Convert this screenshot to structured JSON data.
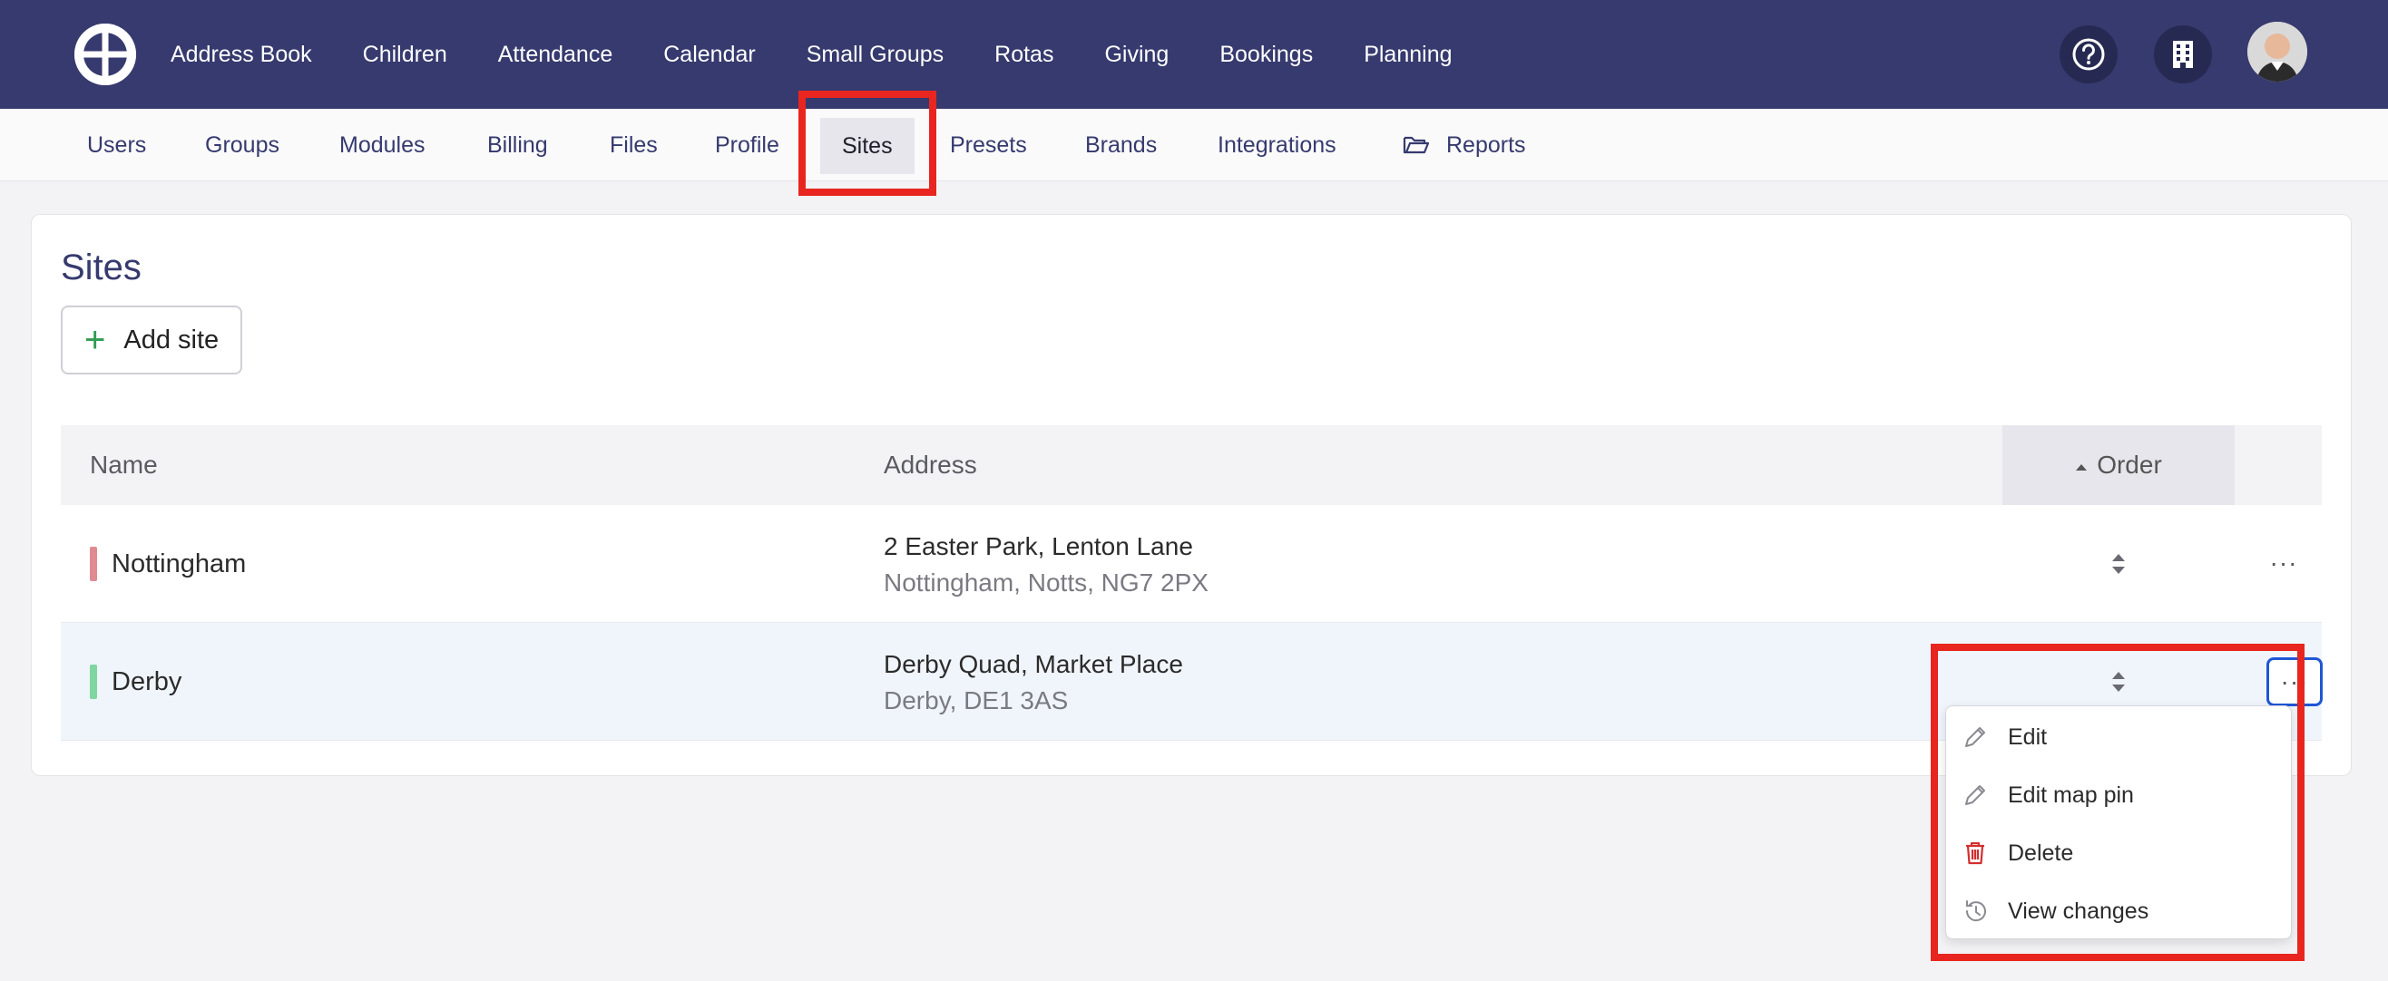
{
  "topnav": {
    "items": [
      "Address Book",
      "Children",
      "Attendance",
      "Calendar",
      "Small Groups",
      "Rotas",
      "Giving",
      "Bookings",
      "Planning"
    ]
  },
  "subnav": {
    "items": [
      "Users",
      "Groups",
      "Modules",
      "Billing",
      "Files",
      "Profile",
      "Sites",
      "Presets",
      "Brands",
      "Integrations",
      "Reports"
    ],
    "active": "Sites"
  },
  "page": {
    "title": "Sites",
    "add_label": "Add site"
  },
  "table": {
    "columns": {
      "name": "Name",
      "address": "Address",
      "order": "Order"
    },
    "rows": [
      {
        "name": "Nottingham",
        "addr1": "2 Easter Park, Lenton Lane",
        "addr2": "Nottingham, Notts, NG7 2PX",
        "color": "#e08a92"
      },
      {
        "name": "Derby",
        "addr1": "Derby Quad, Market Place",
        "addr2": "Derby, DE1 3AS",
        "color": "#7fd6a0"
      }
    ]
  },
  "menu": {
    "items": [
      "Edit",
      "Edit map pin",
      "Delete",
      "View changes"
    ],
    "more_label": "···"
  },
  "colors": {
    "nav_bg": "#363a6e",
    "highlight": "#e8261f",
    "focus": "#1f56d6",
    "delete": "#d32f2f"
  }
}
